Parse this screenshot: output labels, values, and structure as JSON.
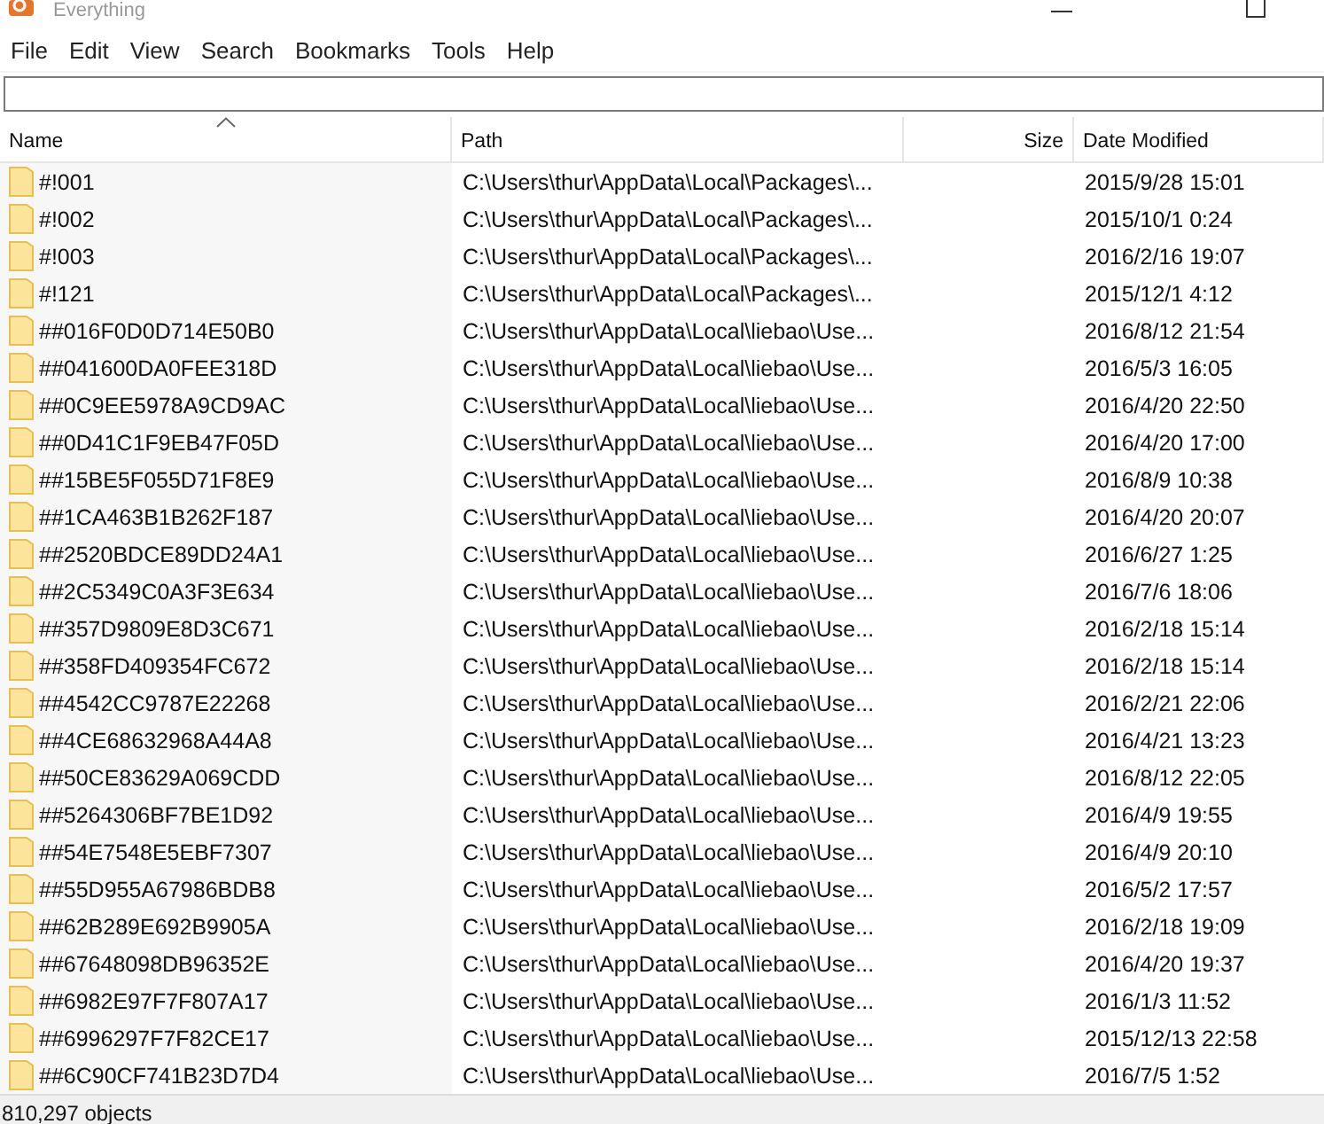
{
  "window": {
    "title": "Everything"
  },
  "menu": [
    "File",
    "Edit",
    "View",
    "Search",
    "Bookmarks",
    "Tools",
    "Help"
  ],
  "table": {
    "columns": [
      "Name",
      "Path",
      "Size",
      "Date Modified"
    ],
    "rows": [
      {
        "name": "#!001",
        "path": "C:\\Users\\thur\\AppData\\Local\\Packages\\...",
        "date": "2015/9/28 15:01"
      },
      {
        "name": "#!002",
        "path": "C:\\Users\\thur\\AppData\\Local\\Packages\\...",
        "date": "2015/10/1 0:24"
      },
      {
        "name": "#!003",
        "path": "C:\\Users\\thur\\AppData\\Local\\Packages\\...",
        "date": "2016/2/16 19:07"
      },
      {
        "name": "#!121",
        "path": "C:\\Users\\thur\\AppData\\Local\\Packages\\...",
        "date": "2015/12/1 4:12"
      },
      {
        "name": "##016F0D0D714E50B0",
        "path": "C:\\Users\\thur\\AppData\\Local\\liebao\\Use...",
        "date": "2016/8/12 21:54"
      },
      {
        "name": "##041600DA0FEE318D",
        "path": "C:\\Users\\thur\\AppData\\Local\\liebao\\Use...",
        "date": "2016/5/3 16:05"
      },
      {
        "name": "##0C9EE5978A9CD9AC",
        "path": "C:\\Users\\thur\\AppData\\Local\\liebao\\Use...",
        "date": "2016/4/20 22:50"
      },
      {
        "name": "##0D41C1F9EB47F05D",
        "path": "C:\\Users\\thur\\AppData\\Local\\liebao\\Use...",
        "date": "2016/4/20 17:00"
      },
      {
        "name": "##15BE5F055D71F8E9",
        "path": "C:\\Users\\thur\\AppData\\Local\\liebao\\Use...",
        "date": "2016/8/9 10:38"
      },
      {
        "name": "##1CA463B1B262F187",
        "path": "C:\\Users\\thur\\AppData\\Local\\liebao\\Use...",
        "date": "2016/4/20 20:07"
      },
      {
        "name": "##2520BDCE89DD24A1",
        "path": "C:\\Users\\thur\\AppData\\Local\\liebao\\Use...",
        "date": "2016/6/27 1:25"
      },
      {
        "name": "##2C5349C0A3F3E634",
        "path": "C:\\Users\\thur\\AppData\\Local\\liebao\\Use...",
        "date": "2016/7/6 18:06"
      },
      {
        "name": "##357D9809E8D3C671",
        "path": "C:\\Users\\thur\\AppData\\Local\\liebao\\Use...",
        "date": "2016/2/18 15:14"
      },
      {
        "name": "##358FD409354FC672",
        "path": "C:\\Users\\thur\\AppData\\Local\\liebao\\Use...",
        "date": "2016/2/18 15:14"
      },
      {
        "name": "##4542CC9787E22268",
        "path": "C:\\Users\\thur\\AppData\\Local\\liebao\\Use...",
        "date": "2016/2/21 22:06"
      },
      {
        "name": "##4CE68632968A44A8",
        "path": "C:\\Users\\thur\\AppData\\Local\\liebao\\Use...",
        "date": "2016/4/21 13:23"
      },
      {
        "name": "##50CE83629A069CDD",
        "path": "C:\\Users\\thur\\AppData\\Local\\liebao\\Use...",
        "date": "2016/8/12 22:05"
      },
      {
        "name": "##5264306BF7BE1D92",
        "path": "C:\\Users\\thur\\AppData\\Local\\liebao\\Use...",
        "date": "2016/4/9 19:55"
      },
      {
        "name": "##54E7548E5EBF7307",
        "path": "C:\\Users\\thur\\AppData\\Local\\liebao\\Use...",
        "date": "2016/4/9 20:10"
      },
      {
        "name": "##55D955A67986BDB8",
        "path": "C:\\Users\\thur\\AppData\\Local\\liebao\\Use...",
        "date": "2016/5/2 17:57"
      },
      {
        "name": "##62B289E692B9905A",
        "path": "C:\\Users\\thur\\AppData\\Local\\liebao\\Use...",
        "date": "2016/2/18 19:09"
      },
      {
        "name": "##67648098DB96352E",
        "path": "C:\\Users\\thur\\AppData\\Local\\liebao\\Use...",
        "date": "2016/4/20 19:37"
      },
      {
        "name": "##6982E97F7F807A17",
        "path": "C:\\Users\\thur\\AppData\\Local\\liebao\\Use...",
        "date": "2016/1/3 11:52"
      },
      {
        "name": "##6996297F7F82CE17",
        "path": "C:\\Users\\thur\\AppData\\Local\\liebao\\Use...",
        "date": "2015/12/13 22:58"
      },
      {
        "name": "##6C90CF741B23D7D4",
        "path": "C:\\Users\\thur\\AppData\\Local\\liebao\\Use...",
        "date": "2016/7/5 1:52"
      }
    ]
  },
  "status_bar": "810,297 objects"
}
